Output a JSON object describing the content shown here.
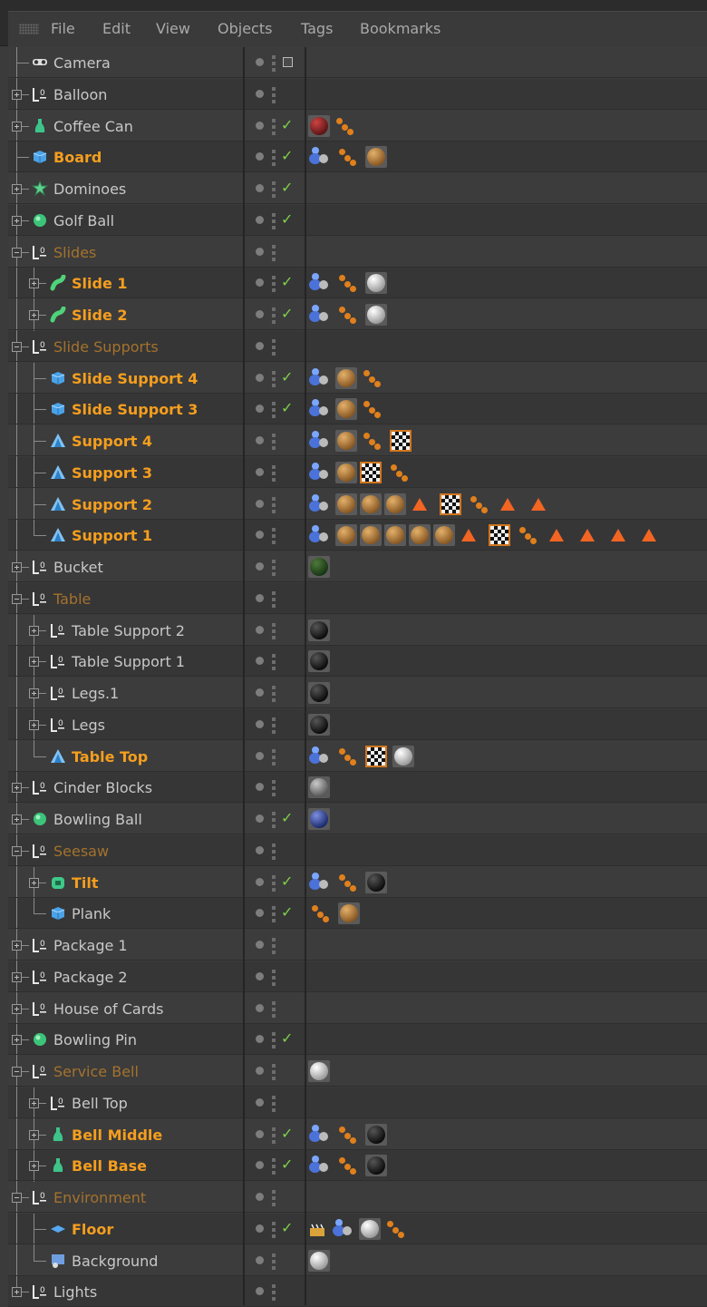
{
  "menu": [
    "File",
    "Edit",
    "View",
    "Objects",
    "Tags",
    "Bookmarks"
  ],
  "rows": [
    {
      "name": "Camera",
      "state": "normal",
      "icon": "camera-icon",
      "depth": 0,
      "exp": "none",
      "check": false,
      "camtag": true,
      "tags": []
    },
    {
      "name": "Balloon",
      "state": "normal",
      "icon": "null-icon",
      "depth": 0,
      "exp": "collapsed",
      "check": false,
      "tags": []
    },
    {
      "name": "Coffee Can",
      "state": "normal",
      "icon": "lathe-icon",
      "depth": 0,
      "exp": "collapsed",
      "check": true,
      "tags": [
        "mat:darkred",
        "dots"
      ]
    },
    {
      "name": "Board",
      "state": "sel",
      "icon": "cube-icon",
      "depth": 0,
      "exp": "none",
      "check": true,
      "tags": [
        "people",
        "dots",
        "mat:brown"
      ]
    },
    {
      "name": "Dominoes",
      "state": "normal",
      "icon": "cloner-icon",
      "depth": 0,
      "exp": "collapsed",
      "check": true,
      "tags": []
    },
    {
      "name": "Golf Ball",
      "state": "normal",
      "icon": "sphere-icon",
      "depth": 0,
      "exp": "collapsed",
      "check": true,
      "tags": []
    },
    {
      "name": "Slides",
      "state": "dim",
      "icon": "null-icon",
      "depth": 0,
      "exp": "expanded",
      "check": false,
      "tags": []
    },
    {
      "name": "Slide 1",
      "state": "sel",
      "icon": "sweep-icon",
      "depth": 1,
      "exp": "collapsed",
      "check": true,
      "tags": [
        "people",
        "dots",
        "mat:white"
      ]
    },
    {
      "name": "Slide 2",
      "state": "sel",
      "icon": "sweep-icon",
      "depth": 1,
      "exp": "collapsed",
      "check": true,
      "tags": [
        "people",
        "dots",
        "mat:white"
      ]
    },
    {
      "name": "Slide Supports",
      "state": "dim",
      "icon": "null-icon",
      "depth": 0,
      "exp": "expanded",
      "check": false,
      "tags": []
    },
    {
      "name": "Slide Support 4",
      "state": "sel",
      "icon": "cube-icon",
      "depth": 1,
      "exp": "none",
      "check": true,
      "tags": [
        "people",
        "mat:brown",
        "dots"
      ]
    },
    {
      "name": "Slide Support 3",
      "state": "sel",
      "icon": "cube-icon",
      "depth": 1,
      "exp": "none",
      "check": true,
      "tags": [
        "people",
        "mat:brown",
        "dots"
      ]
    },
    {
      "name": "Support 4",
      "state": "sel",
      "icon": "polygon-icon",
      "depth": 1,
      "exp": "none",
      "check": false,
      "tags": [
        "people",
        "mat:brown",
        "dots",
        "tex"
      ]
    },
    {
      "name": "Support 3",
      "state": "sel",
      "icon": "polygon-icon",
      "depth": 1,
      "exp": "none",
      "check": false,
      "tags": [
        "people",
        "mat:brown",
        "tex",
        "dots"
      ]
    },
    {
      "name": "Support 2",
      "state": "sel",
      "icon": "polygon-icon",
      "depth": 1,
      "exp": "none",
      "check": false,
      "tags": [
        "people",
        "mat:brown",
        "mat:brown",
        "mat:brown",
        "tri",
        "tex",
        "dots",
        "tri",
        "tri"
      ]
    },
    {
      "name": "Support 1",
      "state": "sel",
      "icon": "polygon-icon",
      "depth": 1,
      "exp": "none",
      "last": true,
      "check": false,
      "tags": [
        "people",
        "mat:brown",
        "mat:brown",
        "mat:brown",
        "mat:brown",
        "mat:brown",
        "tri",
        "tex",
        "dots",
        "tri",
        "tri",
        "tri",
        "tri"
      ]
    },
    {
      "name": "Bucket",
      "state": "normal",
      "icon": "null-icon",
      "depth": 0,
      "exp": "collapsed",
      "check": false,
      "tags": [
        "mat:darkgreen"
      ]
    },
    {
      "name": "Table",
      "state": "dim",
      "icon": "null-icon",
      "depth": 0,
      "exp": "expanded",
      "check": false,
      "tags": []
    },
    {
      "name": "Table Support 2",
      "state": "normal",
      "icon": "null-icon",
      "depth": 1,
      "exp": "collapsed",
      "check": false,
      "tags": [
        "mat:black"
      ]
    },
    {
      "name": "Table Support 1",
      "state": "normal",
      "icon": "null-icon",
      "depth": 1,
      "exp": "collapsed",
      "check": false,
      "tags": [
        "mat:black"
      ]
    },
    {
      "name": "Legs.1",
      "state": "normal",
      "icon": "null-icon",
      "depth": 1,
      "exp": "collapsed",
      "check": false,
      "tags": [
        "mat:black"
      ]
    },
    {
      "name": "Legs",
      "state": "normal",
      "icon": "null-icon",
      "depth": 1,
      "exp": "collapsed",
      "check": false,
      "tags": [
        "mat:black"
      ]
    },
    {
      "name": "Table Top",
      "state": "sel",
      "icon": "polygon-icon",
      "depth": 1,
      "exp": "none",
      "last": true,
      "check": false,
      "tags": [
        "people",
        "dots",
        "tex",
        "mat:white"
      ]
    },
    {
      "name": "Cinder Blocks",
      "state": "normal",
      "icon": "null-icon",
      "depth": 0,
      "exp": "collapsed",
      "check": false,
      "tags": [
        "mat:gray"
      ]
    },
    {
      "name": "Bowling Ball",
      "state": "normal",
      "icon": "sphere-icon",
      "depth": 0,
      "exp": "collapsed",
      "check": true,
      "tags": [
        "mat:blue"
      ]
    },
    {
      "name": "Seesaw",
      "state": "dim",
      "icon": "null-icon",
      "depth": 0,
      "exp": "expanded",
      "check": false,
      "tags": []
    },
    {
      "name": "Tilt",
      "state": "sel",
      "icon": "rounded-cube-icon",
      "depth": 1,
      "exp": "collapsed",
      "check": true,
      "tags": [
        "people",
        "dots",
        "mat:black"
      ]
    },
    {
      "name": "Plank",
      "state": "normal",
      "icon": "cube-icon",
      "depth": 1,
      "exp": "none",
      "last": true,
      "check": true,
      "tags": [
        "dots",
        "mat:brown"
      ]
    },
    {
      "name": "Package 1",
      "state": "normal",
      "icon": "null-icon",
      "depth": 0,
      "exp": "collapsed",
      "check": false,
      "tags": []
    },
    {
      "name": "Package 2",
      "state": "normal",
      "icon": "null-icon",
      "depth": 0,
      "exp": "collapsed",
      "check": false,
      "tags": []
    },
    {
      "name": "House of Cards",
      "state": "normal",
      "icon": "null-icon",
      "depth": 0,
      "exp": "collapsed",
      "check": false,
      "tags": []
    },
    {
      "name": "Bowling Pin",
      "state": "normal",
      "icon": "sphere-icon",
      "depth": 0,
      "exp": "collapsed",
      "check": true,
      "tags": []
    },
    {
      "name": "Service Bell",
      "state": "dim",
      "icon": "null-icon",
      "depth": 0,
      "exp": "expanded",
      "check": false,
      "tags": [
        "mat:white"
      ]
    },
    {
      "name": "Bell Top",
      "state": "normal",
      "icon": "null-icon",
      "depth": 1,
      "exp": "collapsed",
      "check": false,
      "tags": []
    },
    {
      "name": "Bell Middle",
      "state": "sel",
      "icon": "lathe-icon",
      "depth": 1,
      "exp": "collapsed",
      "check": true,
      "tags": [
        "people",
        "dots",
        "mat:black"
      ]
    },
    {
      "name": "Bell Base",
      "state": "sel",
      "icon": "lathe-icon",
      "depth": 1,
      "exp": "collapsed",
      "check": true,
      "tags": [
        "people",
        "dots",
        "mat:black"
      ]
    },
    {
      "name": "Environment",
      "state": "dim",
      "icon": "null-icon",
      "depth": 0,
      "exp": "expanded",
      "check": false,
      "tags": []
    },
    {
      "name": "Floor",
      "state": "sel",
      "icon": "floor-icon",
      "depth": 1,
      "exp": "none",
      "check": true,
      "tags": [
        "clap",
        "people",
        "mat:white",
        "dots"
      ]
    },
    {
      "name": "Background",
      "state": "normal",
      "icon": "background-icon",
      "depth": 1,
      "exp": "none",
      "last": true,
      "check": false,
      "tags": [
        "mat:white"
      ]
    },
    {
      "name": "Lights",
      "state": "normal",
      "icon": "null-icon",
      "depth": 0,
      "exp": "collapsed",
      "check": false,
      "tags": []
    }
  ]
}
